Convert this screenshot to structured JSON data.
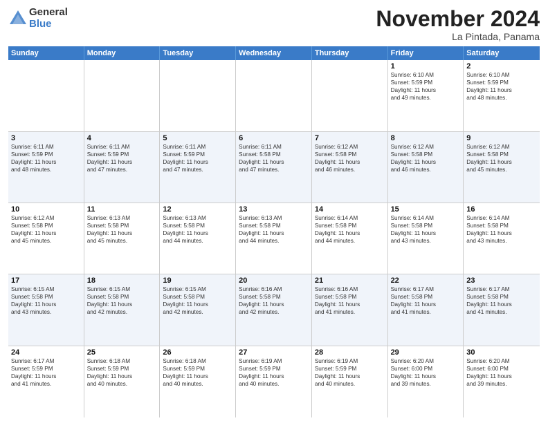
{
  "logo": {
    "general": "General",
    "blue": "Blue"
  },
  "title": "November 2024",
  "subtitle": "La Pintada, Panama",
  "days": [
    "Sunday",
    "Monday",
    "Tuesday",
    "Wednesday",
    "Thursday",
    "Friday",
    "Saturday"
  ],
  "weeks": [
    [
      {
        "day": "",
        "info": ""
      },
      {
        "day": "",
        "info": ""
      },
      {
        "day": "",
        "info": ""
      },
      {
        "day": "",
        "info": ""
      },
      {
        "day": "",
        "info": ""
      },
      {
        "day": "1",
        "info": "Sunrise: 6:10 AM\nSunset: 5:59 PM\nDaylight: 11 hours\nand 49 minutes."
      },
      {
        "day": "2",
        "info": "Sunrise: 6:10 AM\nSunset: 5:59 PM\nDaylight: 11 hours\nand 48 minutes."
      }
    ],
    [
      {
        "day": "3",
        "info": "Sunrise: 6:11 AM\nSunset: 5:59 PM\nDaylight: 11 hours\nand 48 minutes."
      },
      {
        "day": "4",
        "info": "Sunrise: 6:11 AM\nSunset: 5:59 PM\nDaylight: 11 hours\nand 47 minutes."
      },
      {
        "day": "5",
        "info": "Sunrise: 6:11 AM\nSunset: 5:59 PM\nDaylight: 11 hours\nand 47 minutes."
      },
      {
        "day": "6",
        "info": "Sunrise: 6:11 AM\nSunset: 5:58 PM\nDaylight: 11 hours\nand 47 minutes."
      },
      {
        "day": "7",
        "info": "Sunrise: 6:12 AM\nSunset: 5:58 PM\nDaylight: 11 hours\nand 46 minutes."
      },
      {
        "day": "8",
        "info": "Sunrise: 6:12 AM\nSunset: 5:58 PM\nDaylight: 11 hours\nand 46 minutes."
      },
      {
        "day": "9",
        "info": "Sunrise: 6:12 AM\nSunset: 5:58 PM\nDaylight: 11 hours\nand 45 minutes."
      }
    ],
    [
      {
        "day": "10",
        "info": "Sunrise: 6:12 AM\nSunset: 5:58 PM\nDaylight: 11 hours\nand 45 minutes."
      },
      {
        "day": "11",
        "info": "Sunrise: 6:13 AM\nSunset: 5:58 PM\nDaylight: 11 hours\nand 45 minutes."
      },
      {
        "day": "12",
        "info": "Sunrise: 6:13 AM\nSunset: 5:58 PM\nDaylight: 11 hours\nand 44 minutes."
      },
      {
        "day": "13",
        "info": "Sunrise: 6:13 AM\nSunset: 5:58 PM\nDaylight: 11 hours\nand 44 minutes."
      },
      {
        "day": "14",
        "info": "Sunrise: 6:14 AM\nSunset: 5:58 PM\nDaylight: 11 hours\nand 44 minutes."
      },
      {
        "day": "15",
        "info": "Sunrise: 6:14 AM\nSunset: 5:58 PM\nDaylight: 11 hours\nand 43 minutes."
      },
      {
        "day": "16",
        "info": "Sunrise: 6:14 AM\nSunset: 5:58 PM\nDaylight: 11 hours\nand 43 minutes."
      }
    ],
    [
      {
        "day": "17",
        "info": "Sunrise: 6:15 AM\nSunset: 5:58 PM\nDaylight: 11 hours\nand 43 minutes."
      },
      {
        "day": "18",
        "info": "Sunrise: 6:15 AM\nSunset: 5:58 PM\nDaylight: 11 hours\nand 42 minutes."
      },
      {
        "day": "19",
        "info": "Sunrise: 6:15 AM\nSunset: 5:58 PM\nDaylight: 11 hours\nand 42 minutes."
      },
      {
        "day": "20",
        "info": "Sunrise: 6:16 AM\nSunset: 5:58 PM\nDaylight: 11 hours\nand 42 minutes."
      },
      {
        "day": "21",
        "info": "Sunrise: 6:16 AM\nSunset: 5:58 PM\nDaylight: 11 hours\nand 41 minutes."
      },
      {
        "day": "22",
        "info": "Sunrise: 6:17 AM\nSunset: 5:58 PM\nDaylight: 11 hours\nand 41 minutes."
      },
      {
        "day": "23",
        "info": "Sunrise: 6:17 AM\nSunset: 5:58 PM\nDaylight: 11 hours\nand 41 minutes."
      }
    ],
    [
      {
        "day": "24",
        "info": "Sunrise: 6:17 AM\nSunset: 5:59 PM\nDaylight: 11 hours\nand 41 minutes."
      },
      {
        "day": "25",
        "info": "Sunrise: 6:18 AM\nSunset: 5:59 PM\nDaylight: 11 hours\nand 40 minutes."
      },
      {
        "day": "26",
        "info": "Sunrise: 6:18 AM\nSunset: 5:59 PM\nDaylight: 11 hours\nand 40 minutes."
      },
      {
        "day": "27",
        "info": "Sunrise: 6:19 AM\nSunset: 5:59 PM\nDaylight: 11 hours\nand 40 minutes."
      },
      {
        "day": "28",
        "info": "Sunrise: 6:19 AM\nSunset: 5:59 PM\nDaylight: 11 hours\nand 40 minutes."
      },
      {
        "day": "29",
        "info": "Sunrise: 6:20 AM\nSunset: 6:00 PM\nDaylight: 11 hours\nand 39 minutes."
      },
      {
        "day": "30",
        "info": "Sunrise: 6:20 AM\nSunset: 6:00 PM\nDaylight: 11 hours\nand 39 minutes."
      }
    ]
  ]
}
